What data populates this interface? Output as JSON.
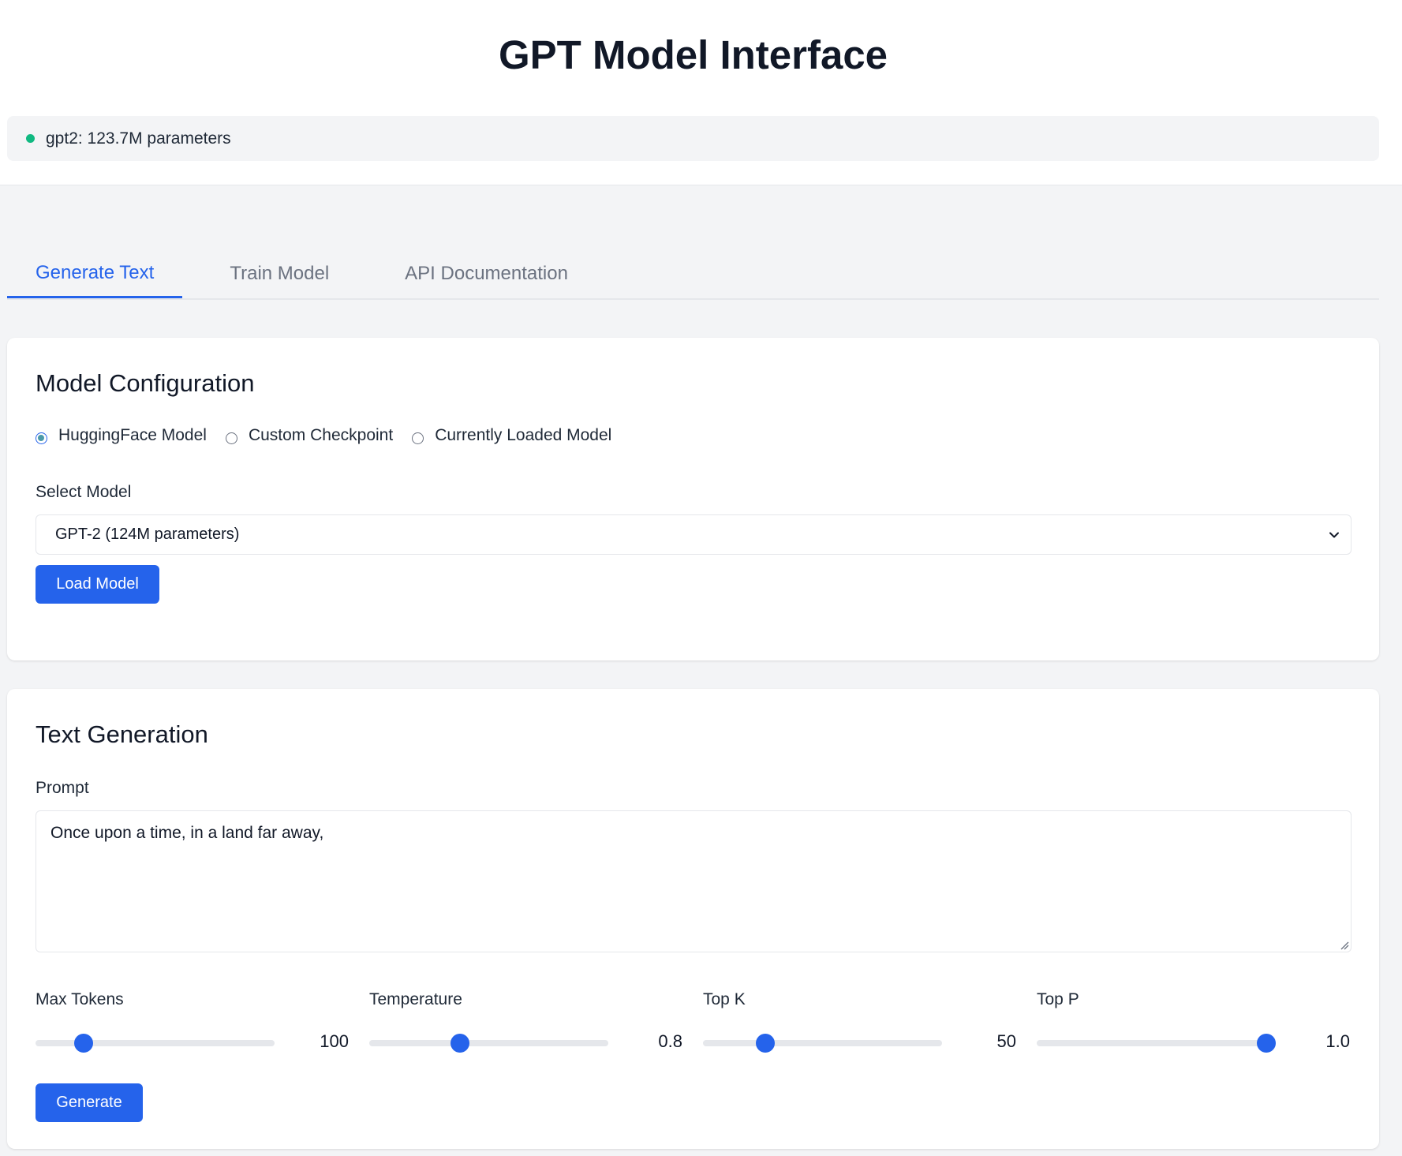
{
  "header": {
    "title": "GPT Model Interface",
    "status_text": "gpt2: 123.7M parameters",
    "status_color": "#10b981"
  },
  "tabs": [
    {
      "label": "Generate Text",
      "active": true
    },
    {
      "label": "Train Model",
      "active": false
    },
    {
      "label": "API Documentation",
      "active": false
    }
  ],
  "model_config": {
    "title": "Model Configuration",
    "radios": [
      {
        "label": "HuggingFace Model",
        "checked": true
      },
      {
        "label": "Custom Checkpoint",
        "checked": false
      },
      {
        "label": "Currently Loaded Model",
        "checked": false
      }
    ],
    "select_label": "Select Model",
    "select_value": "GPT-2 (124M parameters)",
    "load_button": "Load Model"
  },
  "text_generation": {
    "title": "Text Generation",
    "prompt_label": "Prompt",
    "prompt_value": "Once upon a time, in a land far away,",
    "sliders": [
      {
        "label": "Max Tokens",
        "value": "100",
        "fraction": 0.2
      },
      {
        "label": "Temperature",
        "value": "0.8",
        "fraction": 0.38
      },
      {
        "label": "Top K",
        "value": "50",
        "fraction": 0.26
      },
      {
        "label": "Top P",
        "value": "1.0",
        "fraction": 0.96
      }
    ],
    "generate_button": "Generate"
  },
  "colors": {
    "accent": "#2563eb",
    "background": "#f3f4f6",
    "card": "#ffffff"
  }
}
